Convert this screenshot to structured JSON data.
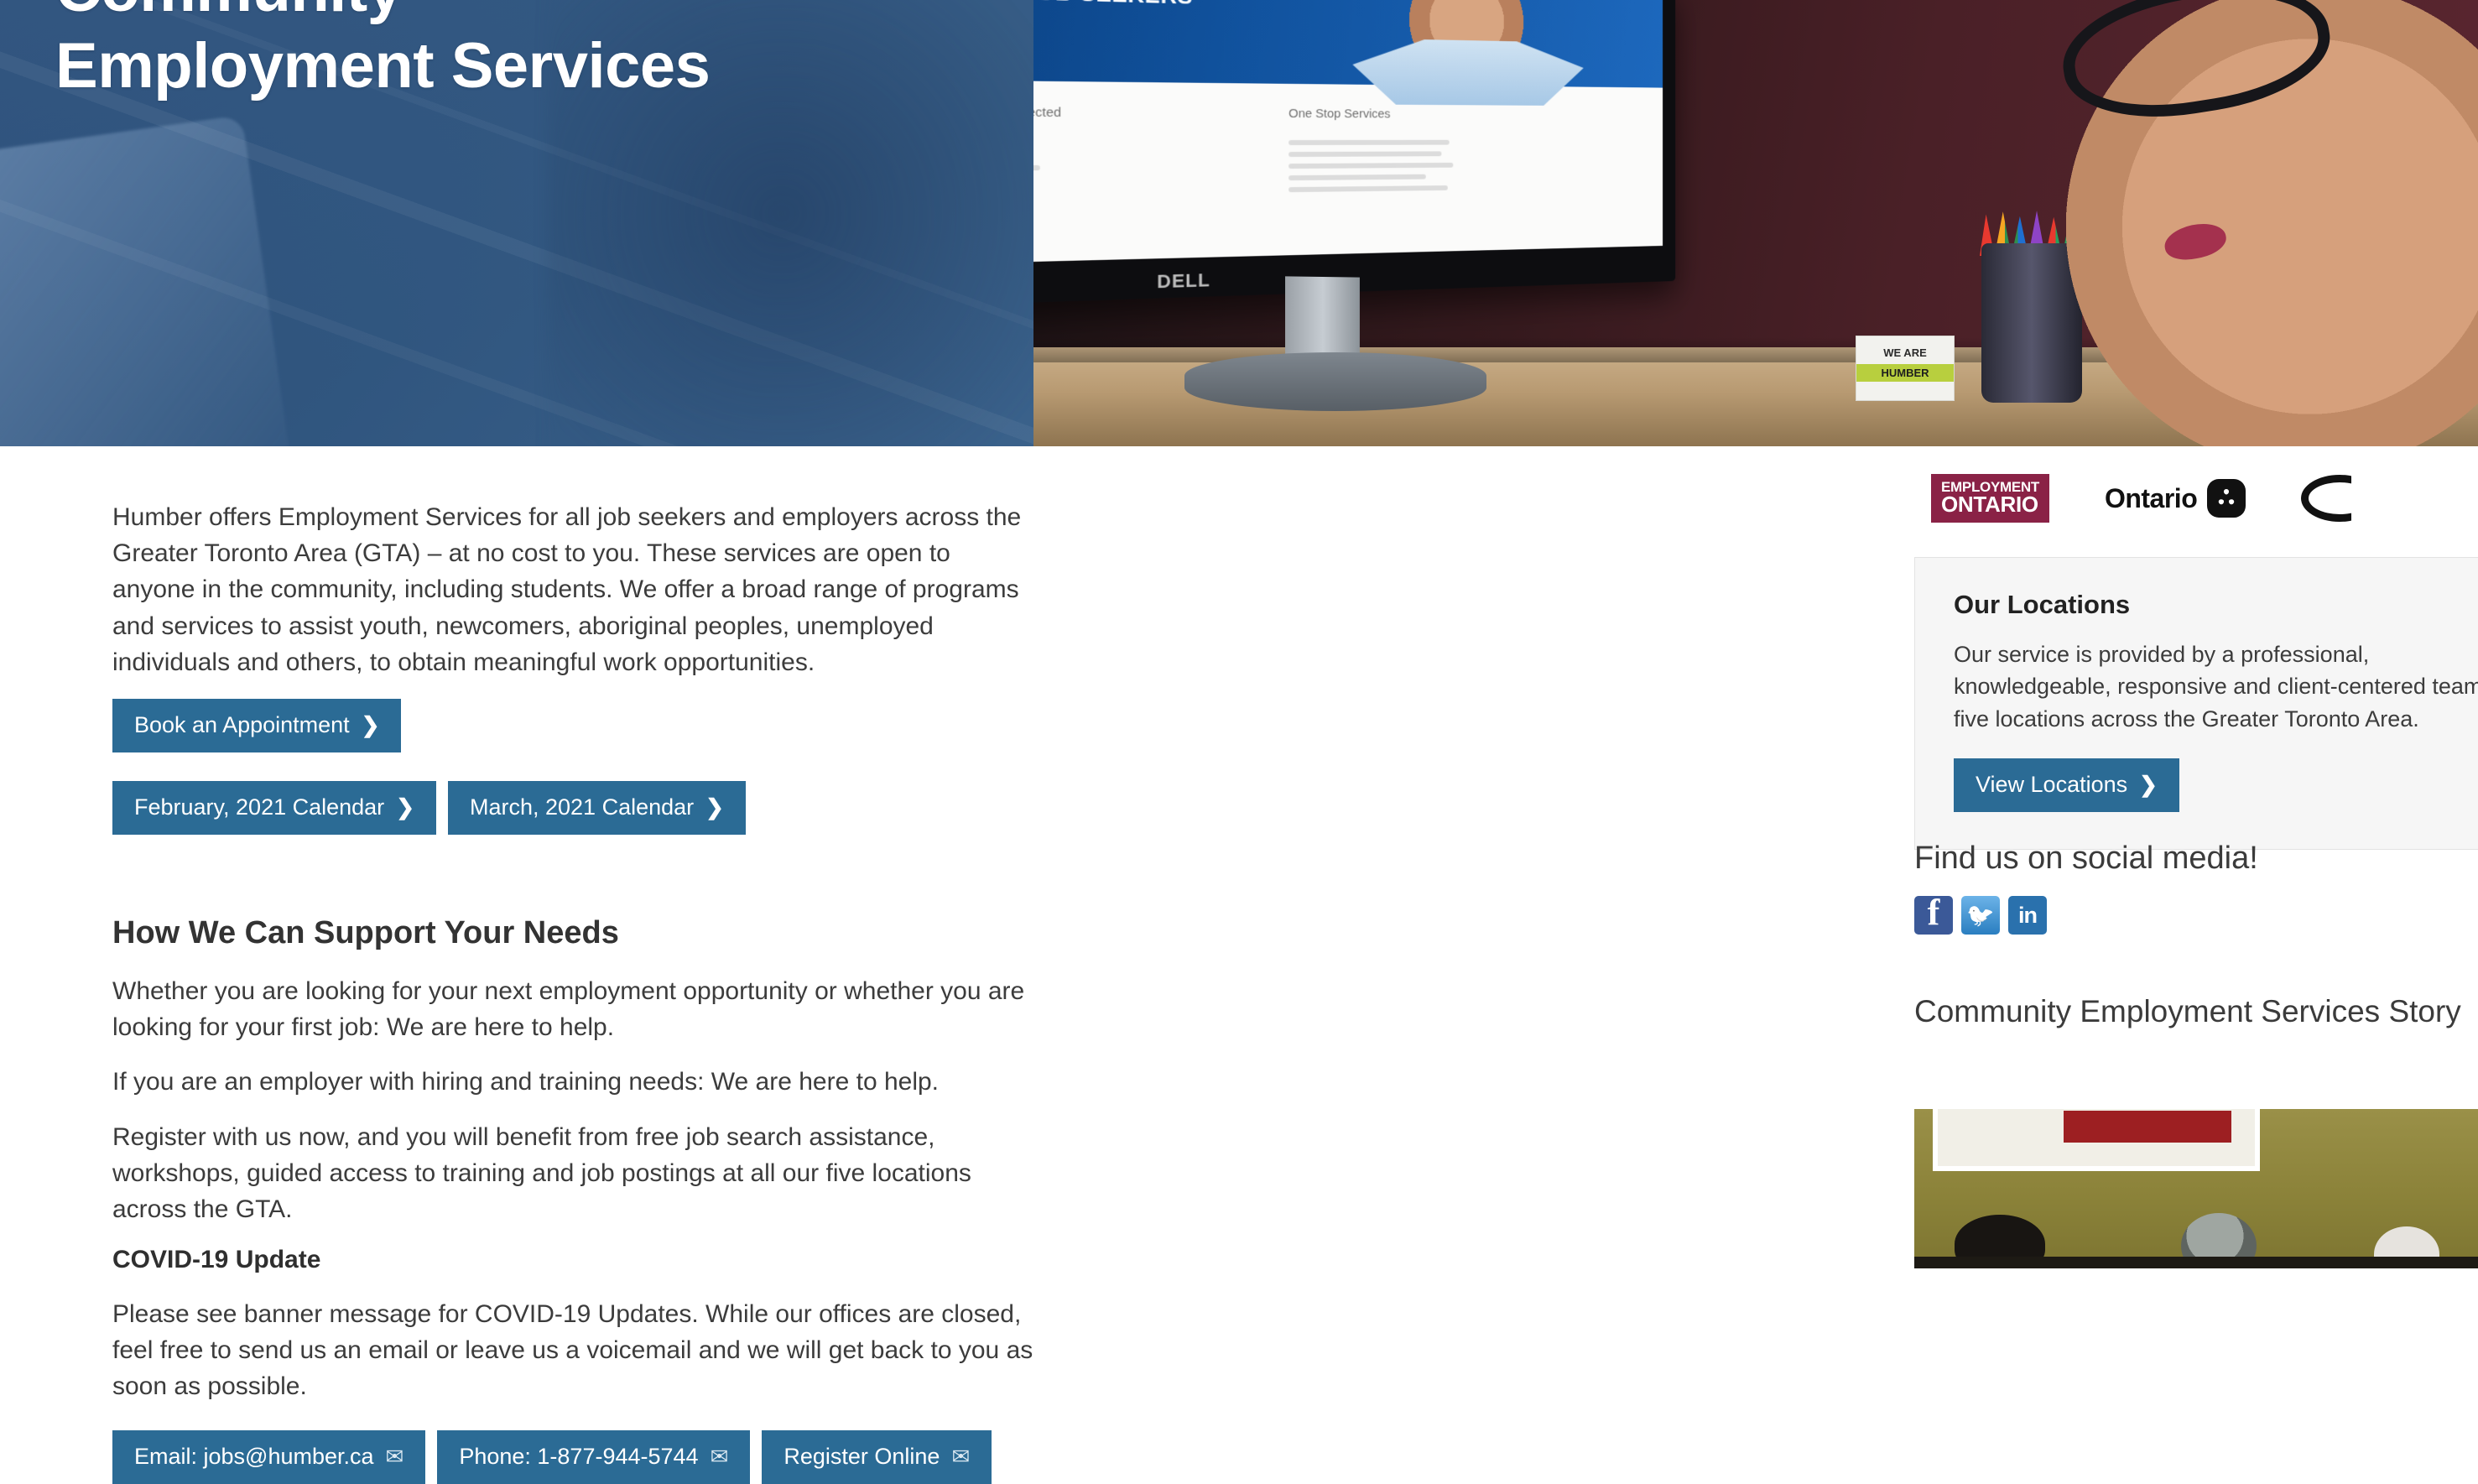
{
  "hero": {
    "title": "Community\nEmployment Services",
    "photo_monitor": {
      "slide_header": "NEEDS OF JOB SEEKERS",
      "col_left_title": "We Are Industry Connected",
      "col_right_title": "One Stop Services",
      "monitor_brand": "DELL"
    },
    "desk_sign": {
      "line1": "WE ARE",
      "line2": "HUMBER"
    }
  },
  "main": {
    "intro": "Humber offers Employment Services for all job seekers and employers across the Greater Toronto Area (GTA) – at no cost to you. These services are open to anyone in the community, including students. We offer a broad range of programs and services to assist youth, newcomers, aboriginal peoples, unemployed individuals and others, to obtain meaningful work opportunities.",
    "book_button": "Book an Appointment",
    "calendar_buttons": [
      "February, 2021 Calendar",
      "March, 2021 Calendar"
    ],
    "support_heading": "How We Can Support Your Needs",
    "support_p1": "Whether you are looking for your next employment opportunity or whether you are looking for your first job: We are here to help.",
    "support_p2": "If you are an employer with hiring and training needs: We are here to help.",
    "support_p3": "Register with us now, and you will benefit from free job search assistance, workshops, guided access to training and job postings at all our five locations across the GTA.",
    "covid_heading": "COVID-19 Update",
    "covid_p": "Please see banner message for COVID-19 Updates. While our offices are closed, feel free to send us an email or leave us a voicemail and we will get back to you as soon as possible.",
    "contact_buttons": [
      "Email: jobs@humber.ca",
      "Phone: 1-877-944-5744",
      "Register Online"
    ]
  },
  "sidebar": {
    "logos": {
      "employment_ontario_line1": "EMPLOYMENT",
      "employment_ontario_line2": "ONTARIO",
      "ontario_word": "Ontario"
    },
    "locations_card": {
      "title": "Our Locations",
      "text": "Our service is provided by a professional, knowledgeable, responsive and client-centered team in five locations across the Greater Toronto Area.",
      "button": "View Locations"
    },
    "social_heading": "Find us on social media!",
    "social": [
      {
        "name": "facebook",
        "label": "f"
      },
      {
        "name": "twitter",
        "label": "t"
      },
      {
        "name": "linkedin",
        "label": "in"
      }
    ],
    "story_heading": "Community Employment Services Story"
  },
  "icons": {
    "chevron_right": "❯",
    "envelope": "✉"
  },
  "colors": {
    "button_blue": "#2b6b95",
    "hero_overlay_blue": "#3d6490",
    "employment_ontario_maroon": "#8a2246",
    "card_bg": "#f6f6f6",
    "facebook": "#3b5998",
    "twitter": "#2a7ec0",
    "linkedin": "#2a71ad"
  }
}
